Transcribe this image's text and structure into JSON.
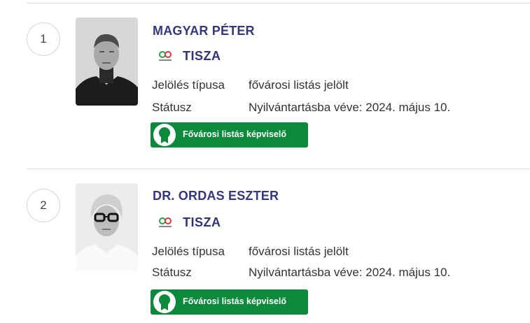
{
  "candidates": [
    {
      "number": "1",
      "name": "MAGYAR PÉTER",
      "party": "TISZA",
      "type_label": "Jelölés típusa",
      "type_value": "fővárosi listás jelölt",
      "status_label": "Státusz",
      "status_value": "Nyilvántartásba véve: 2024. május 10.",
      "badge": "Fővárosi listás képviselő"
    },
    {
      "number": "2",
      "name": "DR. ORDAS ESZTER",
      "party": "TISZA",
      "type_label": "Jelölés típusa",
      "type_value": "fővárosi listás jelölt",
      "status_label": "Státusz",
      "status_value": "Nyilvántartásba véve: 2024. május 10.",
      "badge": "Fővárosi listás képviselő"
    }
  ],
  "colors": {
    "name": "#34387a",
    "badge": "#0a8a3a",
    "divider": "#dcdcdc"
  }
}
